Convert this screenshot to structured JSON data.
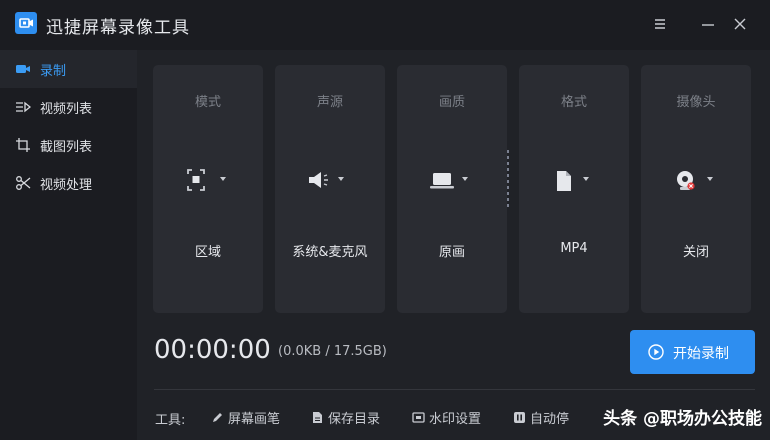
{
  "app": {
    "title": "迅捷屏幕录像工具"
  },
  "window_controls": {
    "menu_icon": "menu-icon",
    "minimize": "minimize-icon",
    "close": "close-icon"
  },
  "sidebar": {
    "items": [
      {
        "label": "录制",
        "icon": "record-icon",
        "active": true
      },
      {
        "label": "视频列表",
        "icon": "video-list-icon",
        "active": false
      },
      {
        "label": "截图列表",
        "icon": "screenshot-list-icon",
        "active": false
      },
      {
        "label": "视频处理",
        "icon": "video-process-icon",
        "active": false
      }
    ]
  },
  "settings": {
    "cards": [
      {
        "title": "模式",
        "value": "区域",
        "icon": "region-icon"
      },
      {
        "title": "声源",
        "value": "系统&麦克风",
        "icon": "speaker-icon"
      },
      {
        "title": "画质",
        "value": "原画",
        "icon": "laptop-icon"
      },
      {
        "title": "格式",
        "value": "MP4",
        "icon": "file-icon"
      },
      {
        "title": "摄像头",
        "value": "关闭",
        "icon": "webcam-off-icon"
      }
    ]
  },
  "status": {
    "timer": "00:00:00",
    "size": "(0.0KB / 17.5GB)"
  },
  "start_button": {
    "label": "开始录制"
  },
  "toolbar": {
    "label": "工具:",
    "items": [
      {
        "label": "屏幕画笔",
        "icon": "pen-icon"
      },
      {
        "label": "保存目录",
        "icon": "folder-file-icon"
      },
      {
        "label": "水印设置",
        "icon": "watermark-icon"
      },
      {
        "label": "自动停",
        "icon": "pause-icon"
      }
    ]
  },
  "watermark": {
    "text": "头条 @职场办公技能"
  },
  "colors": {
    "accent": "#2e8ef0",
    "background": "#202227",
    "card": "#2a2c32",
    "sidebar": "#1b1c21"
  }
}
